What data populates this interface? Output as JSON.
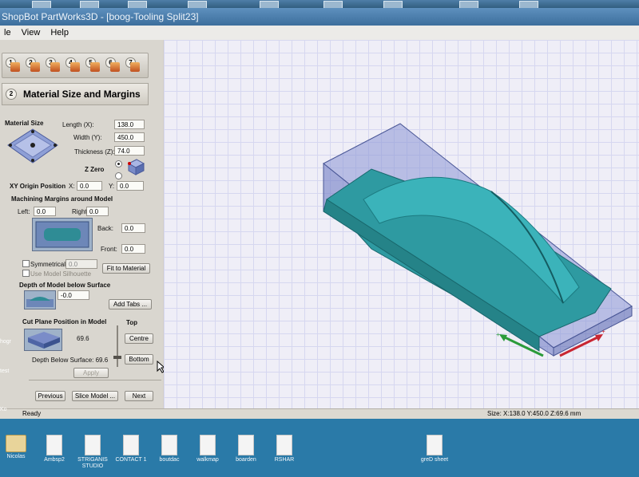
{
  "window": {
    "title": "ShopBot PartWorks3D - [boog-Tooling Split23]"
  },
  "menu": [
    "le",
    "View",
    "Help"
  ],
  "steps": [
    "1",
    "2",
    "3",
    "4",
    "5",
    "6",
    "7"
  ],
  "panel": {
    "step_number": "2",
    "heading": "Material Size and Margins",
    "material_size": {
      "section_label": "Material Size",
      "length_label": "Length (X):",
      "length_value": "138.0",
      "width_label": "Width (Y):",
      "width_value": "450.0",
      "thickness_label": "Thickness (Z):",
      "thickness_value": "74.0",
      "zzero_label": "Z Zero"
    },
    "xy_origin": {
      "label": "XY Origin Position",
      "x_label": "X:",
      "x_value": "0.0",
      "y_label": "Y:",
      "y_value": "0.0"
    },
    "margins": {
      "section_label": "Machining Margins around Model",
      "left_label": "Left:",
      "left_value": "0.0",
      "right_label": "Right:",
      "right_value": "0.0",
      "back_label": "Back:",
      "back_value": "0.0",
      "front_label": "Front:",
      "front_value": "0.0",
      "symmetrical_label": "Symmetrical",
      "symmetrical_value": "0.0",
      "silhouette_label": "Use Model Silhouette",
      "fit_button": "Fit to Material"
    },
    "depth": {
      "section_label": "Depth of Model below Surface",
      "value": "-0.0",
      "tabs_button": "Add Tabs ..."
    },
    "cut_plane": {
      "section_label": "Cut Plane Position in Model",
      "top_label": "Top",
      "value": "69.6",
      "centre_button": "Centre",
      "bottom_button": "Bottom",
      "depth_label": "Depth Below Surface: 69.6",
      "apply_button": "Apply"
    },
    "nav": {
      "previous_button": "Previous",
      "slice_button": "Slice Model ...",
      "next_button": "Next"
    }
  },
  "status": {
    "left": "Ready",
    "right": "Size: X:138.0 Y:450.0 Z:69.6 mm"
  },
  "axis": {
    "green": "+",
    "red": "+"
  },
  "colors": {
    "model": "#2e9aa1",
    "box": "#7d8cc4",
    "x_axis": "#2b9b3a",
    "y_axis": "#c82632"
  },
  "desktop": {
    "left_edge": [
      "hogr",
      "test",
      "Ko"
    ],
    "items": [
      "Nicolas",
      "Ambsp2",
      "STRIGANIS STUDIO",
      "CONTACT 1",
      "boutdac",
      "walkmap",
      "boarden",
      "RSHAR",
      "greD sheet"
    ]
  }
}
